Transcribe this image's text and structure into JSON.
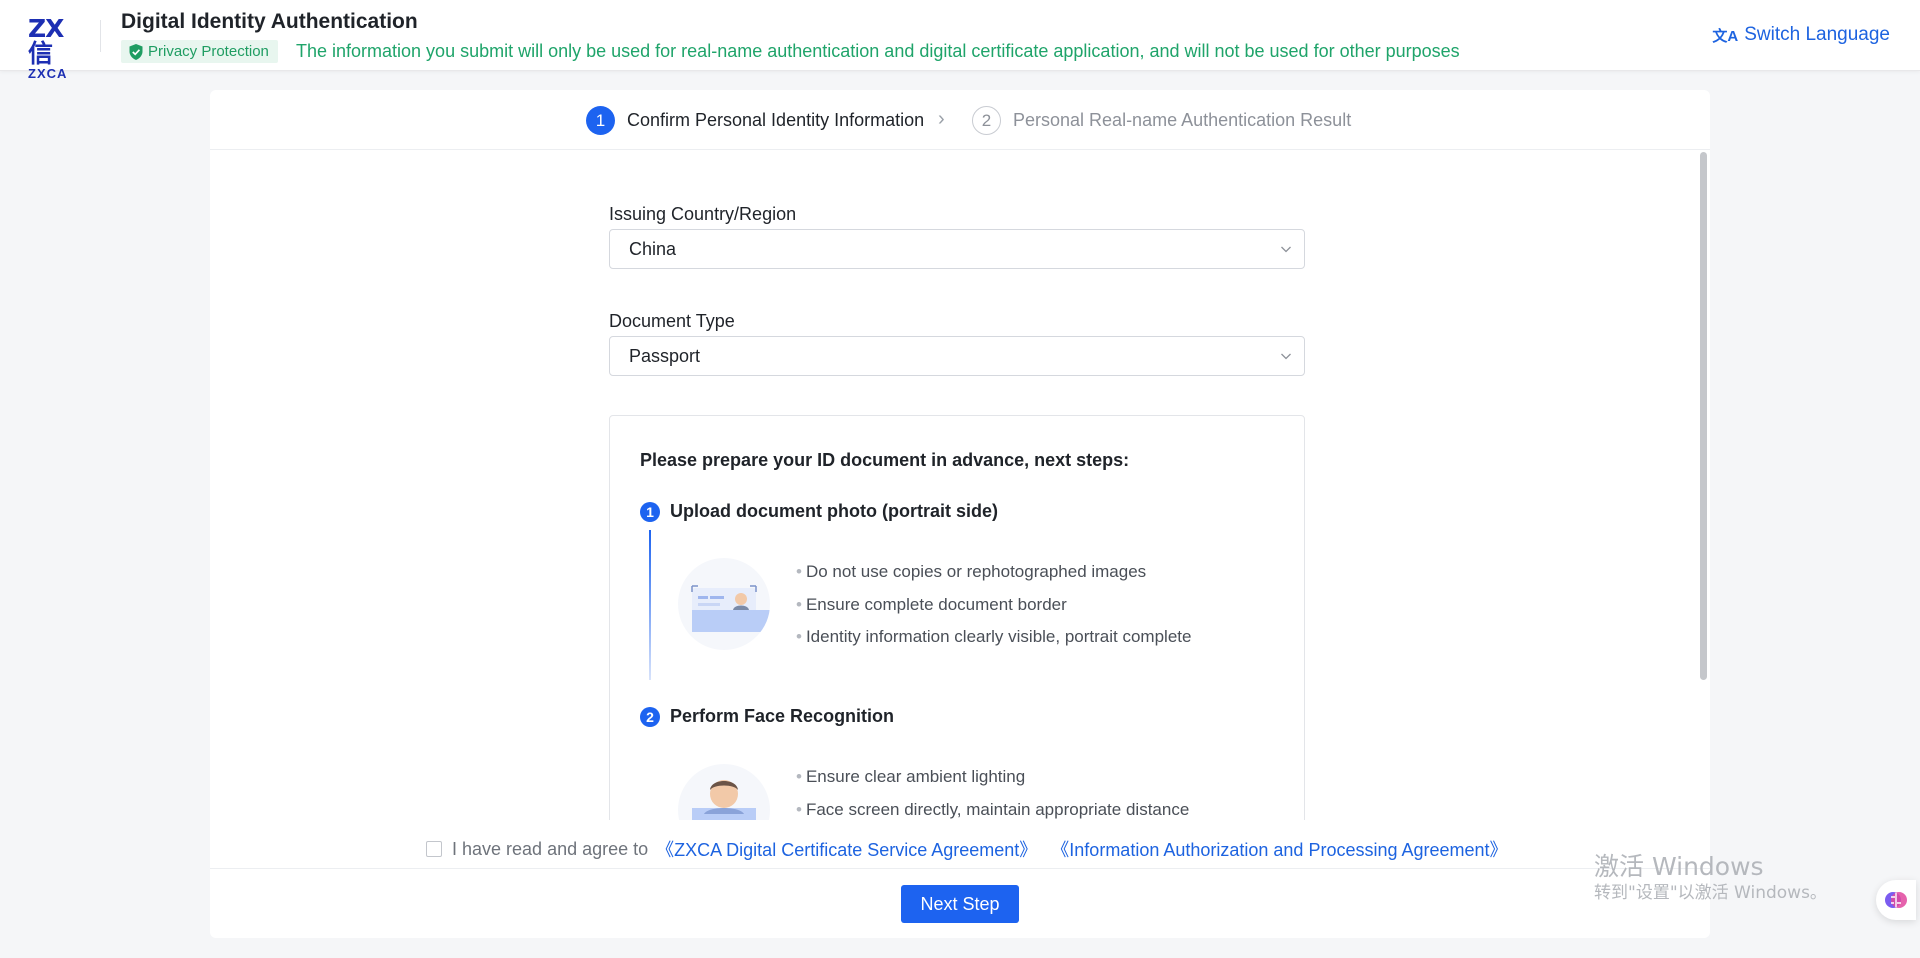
{
  "header": {
    "logo_cn": "ZX信",
    "logo_en": "ZXCA",
    "title": "Digital Identity Authentication",
    "privacy_badge": "Privacy Protection",
    "privacy_text": "The information you submit will only be used for real-name authentication and digital certificate application, and will not be used for other purposes",
    "switch_language": "Switch Language"
  },
  "steps": [
    {
      "num": "1",
      "label": "Confirm Personal Identity Information",
      "active": true
    },
    {
      "num": "2",
      "label": "Personal Real-name Authentication Result",
      "active": false
    }
  ],
  "form": {
    "country_label": "Issuing Country/Region",
    "country_value": "China",
    "doctype_label": "Document Type",
    "doctype_value": "Passport"
  },
  "prep": {
    "title": "Please prepare your ID document in advance, next steps:",
    "steps": [
      {
        "num": "1",
        "title": "Upload document photo (portrait side)",
        "bullets": [
          "Do not use copies or rephotographed images",
          "Ensure complete document border",
          "Identity information clearly visible, portrait complete"
        ]
      },
      {
        "num": "2",
        "title": "Perform Face Recognition",
        "bullets": [
          "Ensure clear ambient lighting",
          "Face screen directly, maintain appropriate distance"
        ]
      }
    ]
  },
  "agreement": {
    "text": "I have read and agree to",
    "link1": "《ZXCA Digital Certificate Service Agreement》",
    "link2": "《Information Authorization and Processing Agreement》"
  },
  "next_button": "Next Step",
  "watermark": {
    "line1": "激活 Windows",
    "line2": "转到\"设置\"以激活 Windows。"
  },
  "colors": {
    "accent": "#1d63f0",
    "privacy_green": "#1fa46a",
    "logo_blue": "#1d2fb3"
  }
}
